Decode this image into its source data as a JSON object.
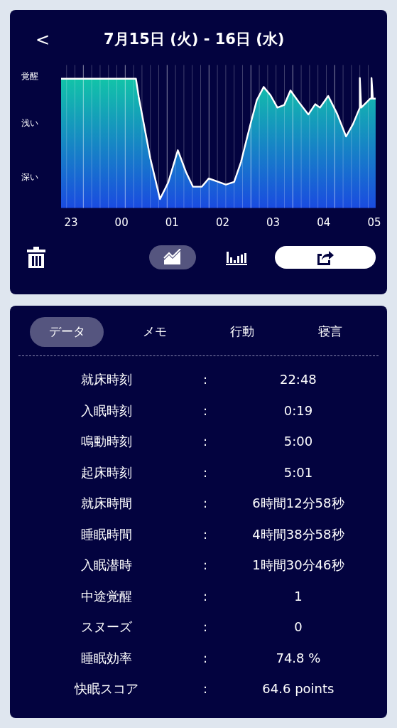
{
  "header": {
    "back": "<",
    "title": "7月15日 (火) - 16日 (水)"
  },
  "chart": {
    "y_labels": [
      "覚醒",
      "浅い",
      "深い"
    ],
    "x_labels": [
      "23",
      "00",
      "01",
      "02",
      "03",
      "04",
      "05"
    ]
  },
  "toolbar": {
    "views": [
      {
        "kind": "line",
        "selected": true
      },
      {
        "kind": "bar",
        "selected": false
      }
    ]
  },
  "tabs": [
    {
      "label": "データ",
      "selected": true
    },
    {
      "label": "メモ",
      "selected": false
    },
    {
      "label": "行動",
      "selected": false
    },
    {
      "label": "寝言",
      "selected": false
    }
  ],
  "rows": [
    {
      "label": "就床時刻",
      "value": "22:48"
    },
    {
      "label": "入眠時刻",
      "value": "0:19"
    },
    {
      "label": "鳴動時刻",
      "value": "5:00"
    },
    {
      "label": "起床時刻",
      "value": "5:01"
    },
    {
      "label": "就床時間",
      "value": "6時間12分58秒"
    },
    {
      "label": "睡眠時間",
      "value": "4時間38分58秒"
    },
    {
      "label": "入眠潜時",
      "value": "1時間30分46秒"
    },
    {
      "label": "中途覚醒",
      "value": "1"
    },
    {
      "label": "スヌーズ",
      "value": "0"
    },
    {
      "label": "睡眠効率",
      "value": "74.8 %"
    },
    {
      "label": "快眠スコア",
      "value": "64.6 points"
    }
  ],
  "separator": ":"
}
